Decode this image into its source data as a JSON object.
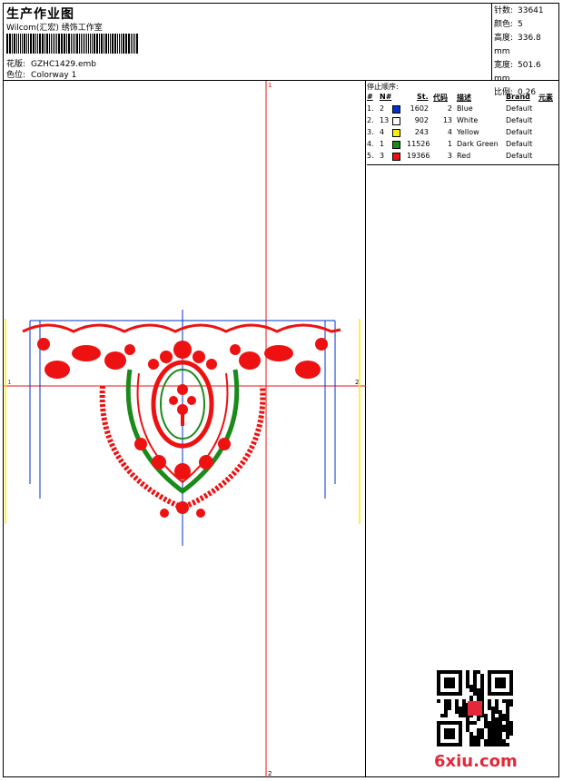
{
  "header": {
    "title": "生产作业图",
    "subtitle": "Wilcom(汇宏) 绣饰工作室",
    "fields": [
      {
        "label": "花版:",
        "value": "GZHC1429.emb"
      },
      {
        "label": "色位:",
        "value": "Colorway 1"
      }
    ]
  },
  "stats": [
    {
      "label": "针数:",
      "value": "33641"
    },
    {
      "label": "颜色:",
      "value": "5"
    },
    {
      "label": "高度:",
      "value": "336.8 mm"
    },
    {
      "label": "宽度:",
      "value": "501.6 mm"
    },
    {
      "label": "比例:",
      "value": "0.26"
    }
  ],
  "stop_sequence": {
    "title": "停止顺序:",
    "headers": {
      "num": "#",
      "n": "N#",
      "st": "St.",
      "code": "代码",
      "desc": "描述",
      "brand": "Brand",
      "elem": "元素"
    },
    "rows": [
      {
        "idx": "1.",
        "n": "2",
        "st": "1602",
        "code": "2",
        "desc": "Blue",
        "brand": "Default",
        "color": "#0033cc"
      },
      {
        "idx": "2.",
        "n": "13",
        "st": "902",
        "code": "13",
        "desc": "White",
        "brand": "Default",
        "color": "#ffffff"
      },
      {
        "idx": "3.",
        "n": "4",
        "st": "243",
        "code": "4",
        "desc": "Yellow",
        "brand": "Default",
        "color": "#ffee00"
      },
      {
        "idx": "4.",
        "n": "1",
        "st": "11526",
        "code": "1",
        "desc": "Dark Green",
        "brand": "Default",
        "color": "#1a8a1a"
      },
      {
        "idx": "5.",
        "n": "3",
        "st": "19366",
        "code": "3",
        "desc": "Red",
        "brand": "Default",
        "color": "#ee1111"
      }
    ]
  },
  "canvas": {
    "axis_marks": {
      "top": "1",
      "bottom": "2",
      "left": "1",
      "right": "2"
    },
    "colors": {
      "red": "#ee1111",
      "green": "#1a8a1a",
      "blue": "#0033cc",
      "yellow": "#ffee00"
    }
  },
  "footer": {
    "logo_text": "6xiu.com",
    "qr": "qr-code"
  }
}
